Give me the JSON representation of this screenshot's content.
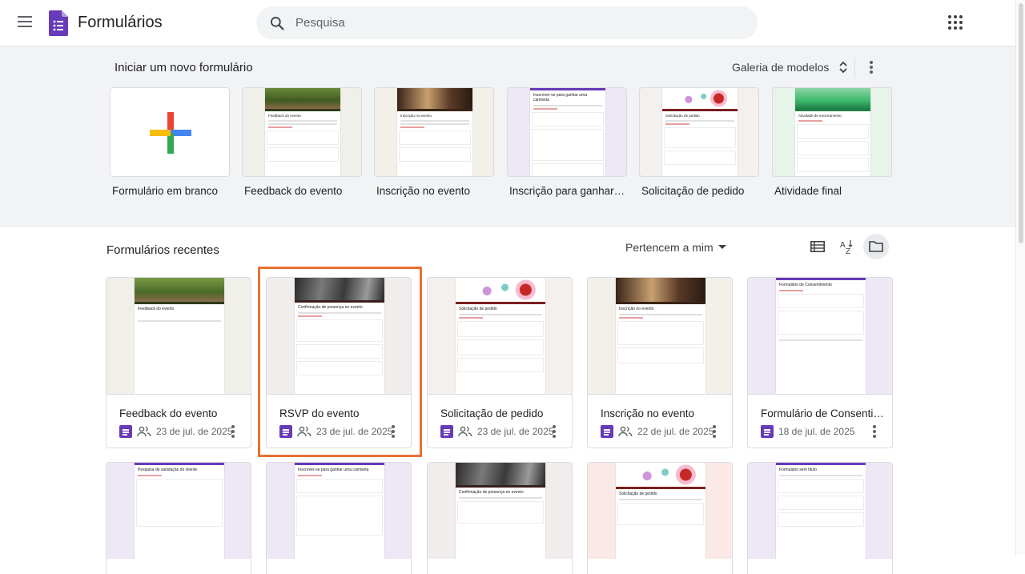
{
  "header": {
    "app_title": "Formulários",
    "search_placeholder": "Pesquisa"
  },
  "templates": {
    "heading": "Iniciar um novo formulário",
    "gallery_label": "Galeria de modelos",
    "items": [
      {
        "name": "Formulário em branco",
        "thumb_title": ""
      },
      {
        "name": "Feedback do evento",
        "thumb_title": "Feedback do evento"
      },
      {
        "name": "Inscrição no evento",
        "thumb_title": "Inscrição no evento"
      },
      {
        "name": "Inscrição para ganhar c...",
        "thumb_title": "Inscrever-se para ganhar uma camiseta"
      },
      {
        "name": "Solicitação de pedido",
        "thumb_title": "Solicitação de pedido"
      },
      {
        "name": "Atividade final",
        "thumb_title": "Atividade de encerramento"
      }
    ]
  },
  "recent": {
    "heading": "Formulários recentes",
    "owner_filter": "Pertencem a mim",
    "docs": [
      {
        "title": "Feedback do evento",
        "date": "23 de jul. de 2025",
        "shared": true,
        "thumb_title": "Feedback do evento"
      },
      {
        "title": "RSVP do evento",
        "date": "23 de jul. de 2025",
        "shared": true,
        "thumb_title": "Confirmação de presença no evento"
      },
      {
        "title": "Solicitação de pedido",
        "date": "23 de jul. de 2025",
        "shared": true,
        "thumb_title": "Solicitação de pedido"
      },
      {
        "title": "Inscrição no evento",
        "date": "22 de jul. de 2025",
        "shared": true,
        "thumb_title": "Inscrição no evento"
      },
      {
        "title": "Formulário de Consentim...",
        "date": "18 de jul. de 2025",
        "shared": false,
        "thumb_title": "Formulário de Consentimento"
      }
    ],
    "docs_row2": [
      {
        "thumb_title": "Pesquisa de satisfação do cliente"
      },
      {
        "thumb_title": "Inscrever-se para ganhar uma camiseta"
      },
      {
        "thumb_title": "Confirmação de presença no evento"
      },
      {
        "thumb_title": "Solicitação de pedido"
      },
      {
        "thumb_title": "Formulário sem título"
      }
    ]
  },
  "colors": {
    "forms_purple": "#673ab7",
    "highlight_orange": "#e87131",
    "template_bg": "#f1f3f4"
  }
}
